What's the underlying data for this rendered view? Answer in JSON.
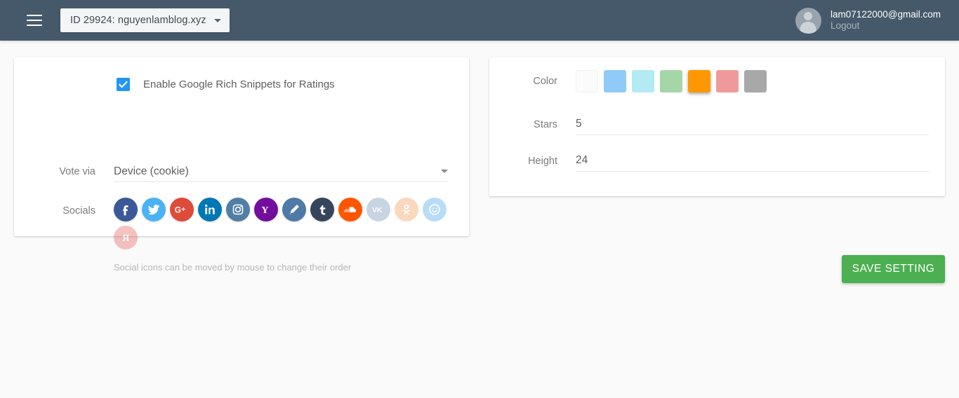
{
  "header": {
    "menu_icon": "hamburger-icon",
    "site_selector_label": "ID 29924: nguyenlamblog.xyz",
    "account_email": "lam07122000@gmail.com",
    "logout_label": "Logout",
    "bar_color": "#45596a"
  },
  "left_card": {
    "rich_snippets": {
      "label": "Enable Google Rich Snippets for Ratings",
      "checked": true,
      "accent_color": "#2196f3"
    },
    "vote_via": {
      "label": "Vote via",
      "value": "Device (cookie)"
    },
    "socials": {
      "label": "Socials",
      "hint": "Social icons can be moved by mouse to change their order",
      "items": [
        {
          "name": "facebook",
          "icon": "facebook-icon",
          "color": "#3b5998",
          "active": true
        },
        {
          "name": "twitter",
          "icon": "twitter-icon",
          "color": "#4ab3f4",
          "active": true
        },
        {
          "name": "google-plus",
          "icon": "google-plus-icon",
          "color": "#dd4b39",
          "active": true
        },
        {
          "name": "linkedin",
          "icon": "linkedin-icon",
          "color": "#0077b5",
          "active": true
        },
        {
          "name": "instagram",
          "icon": "instagram-icon",
          "color": "#517fa4",
          "active": true
        },
        {
          "name": "yahoo",
          "icon": "yahoo-icon",
          "color": "#720e9e",
          "active": true
        },
        {
          "name": "livejournal",
          "icon": "pencil-icon",
          "color": "#4e7aa8",
          "active": true
        },
        {
          "name": "tumblr",
          "icon": "tumblr-icon",
          "color": "#35465c",
          "active": true
        },
        {
          "name": "soundcloud",
          "icon": "soundcloud-icon",
          "color": "#ff5500",
          "active": true
        },
        {
          "name": "vkontakte",
          "icon": "vk-icon",
          "color": "#4c75a3",
          "active": false
        },
        {
          "name": "odnoklassniki",
          "icon": "odnoklassniki-icon",
          "color": "#ed812b",
          "active": false
        },
        {
          "name": "moi-mir",
          "icon": "smiley-icon",
          "color": "#168de2",
          "active": false
        },
        {
          "name": "yandex",
          "icon": "yandex-icon",
          "color": "#e03a2f",
          "active": false
        }
      ]
    }
  },
  "right_card": {
    "color": {
      "label": "Color",
      "selected_index": 4,
      "swatches": [
        {
          "name": "white",
          "hex": "#fbfbfb"
        },
        {
          "name": "blue",
          "hex": "#90caf9"
        },
        {
          "name": "cyan",
          "hex": "#b2ebf2"
        },
        {
          "name": "green",
          "hex": "#a5d6a7"
        },
        {
          "name": "orange",
          "hex": "#ff9800"
        },
        {
          "name": "pink",
          "hex": "#ef9a9a"
        },
        {
          "name": "grey",
          "hex": "#a8a8a8"
        }
      ]
    },
    "stars": {
      "label": "Stars",
      "value": "5"
    },
    "height": {
      "label": "Height",
      "value": "24"
    }
  },
  "actions": {
    "save_label": "SAVE SETTING",
    "save_color": "#4caf50"
  }
}
